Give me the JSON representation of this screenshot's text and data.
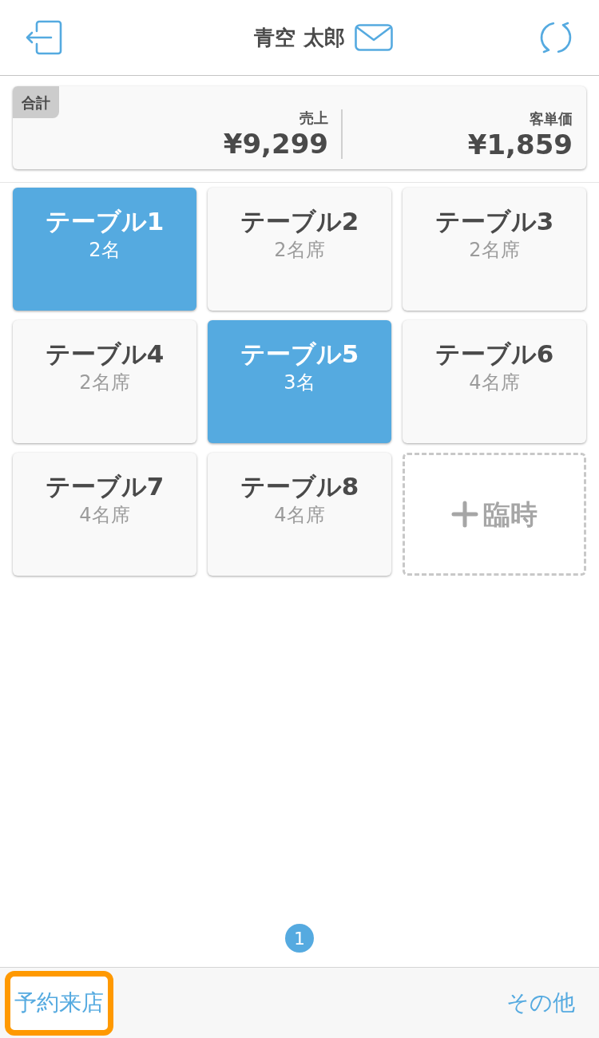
{
  "header": {
    "title": "青空 太郎"
  },
  "summary": {
    "badge": "合計",
    "metrics": [
      {
        "label": "売上",
        "value": "¥9,299"
      },
      {
        "label": "客単価",
        "value": "¥1,859"
      }
    ]
  },
  "tables": [
    {
      "kind": "table",
      "name": "テーブル1",
      "seats": "2名",
      "occupied": true
    },
    {
      "kind": "table",
      "name": "テーブル2",
      "seats": "2名席",
      "occupied": false
    },
    {
      "kind": "table",
      "name": "テーブル3",
      "seats": "2名席",
      "occupied": false
    },
    {
      "kind": "table",
      "name": "テーブル4",
      "seats": "2名席",
      "occupied": false
    },
    {
      "kind": "table",
      "name": "テーブル5",
      "seats": "3名",
      "occupied": true
    },
    {
      "kind": "table",
      "name": "テーブル6",
      "seats": "4名席",
      "occupied": false
    },
    {
      "kind": "table",
      "name": "テーブル7",
      "seats": "4名席",
      "occupied": false
    },
    {
      "kind": "table",
      "name": "テーブル8",
      "seats": "4名席",
      "occupied": false
    },
    {
      "kind": "add",
      "label": "臨時"
    }
  ],
  "pagination": [
    {
      "label": "1",
      "selected": true
    }
  ],
  "footer": {
    "buttons": [
      {
        "label": "予約来店",
        "highlighted": true
      },
      {
        "label": "その他",
        "highlighted": false
      }
    ]
  }
}
